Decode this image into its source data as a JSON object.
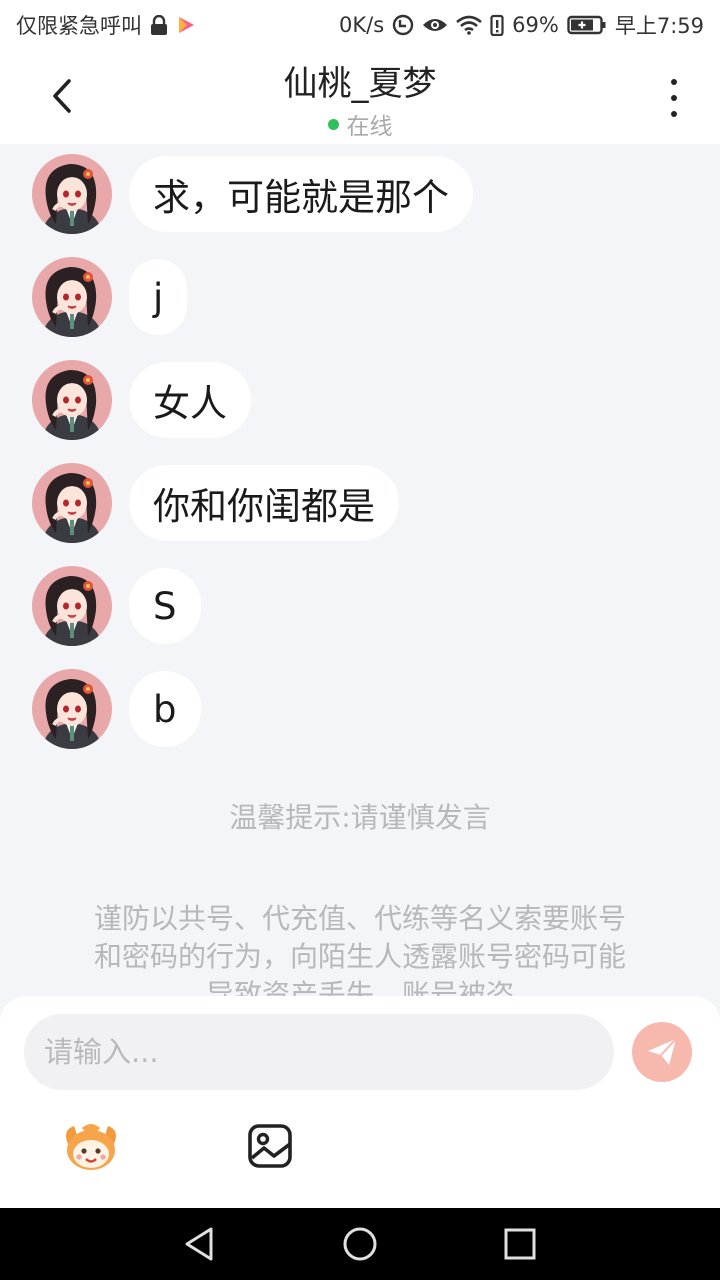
{
  "status_bar": {
    "left_text": "仅限紧急呼叫",
    "speed": "0K/s",
    "battery": "69%",
    "time": "早上7:59"
  },
  "header": {
    "title": "仙桃_夏梦",
    "status": "在线"
  },
  "messages": [
    {
      "text": "求，可能就是那个"
    },
    {
      "text": "j"
    },
    {
      "text": "女人"
    },
    {
      "text": "你和你闺都是"
    },
    {
      "text": "S"
    },
    {
      "text": "b"
    }
  ],
  "tip": "温馨提示:请谨慎发言",
  "warning_lines": [
    "谨防以共号、代充值、代练等名义索要账号",
    "和密码的行为，向陌生人透露账号密码可能",
    "导致资产丢失、账号被盗"
  ],
  "composer": {
    "placeholder": "请输入..."
  },
  "colors": {
    "online": "#2ec05a",
    "send_button": "#f7b9ae",
    "background": "#f4f5f8"
  },
  "icons": [
    "lock-icon",
    "video-app-icon",
    "data-saver-icon",
    "eye-icon",
    "wifi-icon",
    "battery-alert-icon",
    "battery-icon",
    "back-arrow-icon",
    "more-vertical-icon",
    "send-icon",
    "emoji-sticker-icon",
    "image-icon",
    "nav-back-icon",
    "nav-home-icon",
    "nav-recents-icon"
  ]
}
